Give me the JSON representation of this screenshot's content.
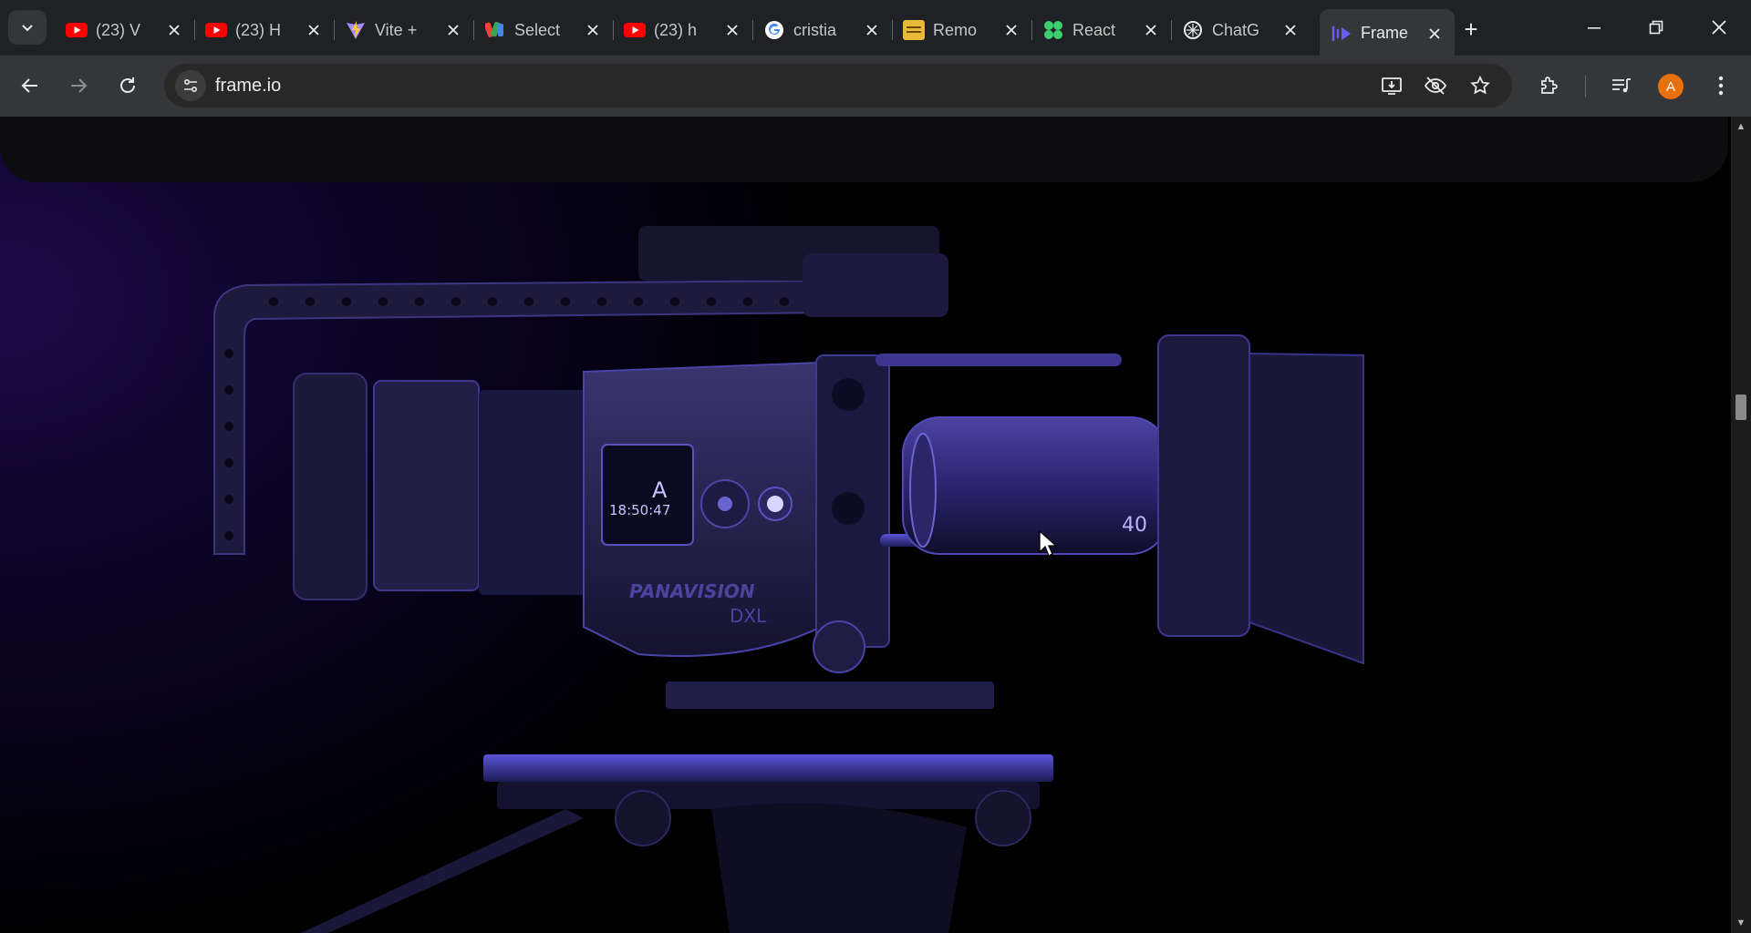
{
  "browser": {
    "tabs": [
      {
        "title": "(23) V",
        "favicon": "youtube-icon",
        "active": false
      },
      {
        "title": "(23) H",
        "favicon": "youtube-icon",
        "active": false
      },
      {
        "title": "Vite +",
        "favicon": "vite-icon",
        "active": false
      },
      {
        "title": "Select",
        "favicon": "select-icon",
        "active": false
      },
      {
        "title": "(23) h",
        "favicon": "youtube-icon",
        "active": false
      },
      {
        "title": "cristia",
        "favicon": "google-icon",
        "active": false
      },
      {
        "title": "Remo",
        "favicon": "remo-icon",
        "active": false
      },
      {
        "title": "React",
        "favicon": "react-flower-icon",
        "active": false
      },
      {
        "title": "ChatG",
        "favicon": "chatgpt-icon",
        "active": false
      },
      {
        "title": "Frame",
        "favicon": "frameio-icon",
        "active": true
      }
    ],
    "address": "frame.io",
    "profile_initial": "A"
  },
  "colors": {
    "youtube": "#ff0000",
    "accent_purple": "#5b4cff",
    "profile": "#e8710a"
  },
  "page": {
    "camera_brand_text": "PANAVISION",
    "camera_model_text": "DXL",
    "camera_display_time": "18:50:47",
    "camera_display_letter": "A",
    "lens_mark": "40"
  }
}
